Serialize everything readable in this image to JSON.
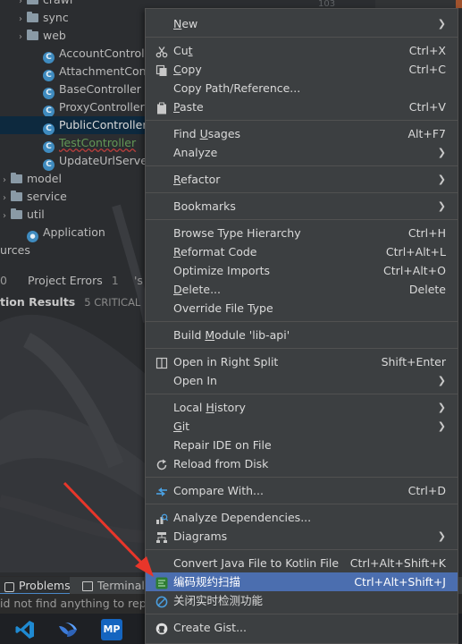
{
  "tree": {
    "items": [
      {
        "label": "crawl",
        "kind": "folder"
      },
      {
        "label": "sync",
        "kind": "folder"
      },
      {
        "label": "web",
        "kind": "folder"
      },
      {
        "label": "AccountController",
        "kind": "class"
      },
      {
        "label": "AttachmentContr",
        "kind": "class"
      },
      {
        "label": "BaseController",
        "kind": "class"
      },
      {
        "label": "ProxyController",
        "kind": "class"
      },
      {
        "label": "PublicController",
        "kind": "class",
        "selected": true
      },
      {
        "label": "TestController",
        "kind": "class",
        "status": "new-file"
      },
      {
        "label": "UpdateUrlServer",
        "kind": "class"
      },
      {
        "label": "model",
        "kind": "folder"
      },
      {
        "label": "service",
        "kind": "folder"
      },
      {
        "label": "util",
        "kind": "folder"
      },
      {
        "label": "Application",
        "kind": "app"
      },
      {
        "label": "urces",
        "kind": "text"
      }
    ]
  },
  "editor": {
    "line_number": "103"
  },
  "tool_tabs": {
    "left_fragment": "0",
    "project_errors": "Project Errors",
    "project_errors_count": "1",
    "right_fragment": "'s"
  },
  "inspection": {
    "title": "tion Results",
    "summary": "5 CRITICAL"
  },
  "status_bar": {
    "problems": "Problems",
    "terminal": "Terminal"
  },
  "message_bar": {
    "text": "id not find anything to repo"
  },
  "taskbar": {
    "icons": [
      "vscode-icon",
      "feishu-icon",
      "mp-icon"
    ],
    "mp_label": "MP"
  },
  "menu": {
    "items": [
      {
        "label": "New",
        "shortcut": "",
        "submenu": true
      },
      {
        "label": "Cut",
        "shortcut": "Ctrl+X",
        "icon": "scissors-icon"
      },
      {
        "label": "Copy",
        "shortcut": "Ctrl+C",
        "icon": "copy-icon"
      },
      {
        "label": "Copy Path/Reference...",
        "shortcut": ""
      },
      {
        "label": "Paste",
        "shortcut": "Ctrl+V",
        "icon": "paste-icon"
      },
      {
        "label": "Find Usages",
        "shortcut": "Alt+F7"
      },
      {
        "label": "Analyze",
        "shortcut": "",
        "submenu": true
      },
      {
        "label": "Refactor",
        "shortcut": "",
        "submenu": true
      },
      {
        "label": "Bookmarks",
        "shortcut": "",
        "submenu": true
      },
      {
        "label": "Browse Type Hierarchy",
        "shortcut": "Ctrl+H"
      },
      {
        "label": "Reformat Code",
        "shortcut": "Ctrl+Alt+L"
      },
      {
        "label": "Optimize Imports",
        "shortcut": "Ctrl+Alt+O"
      },
      {
        "label": "Delete...",
        "shortcut": "Delete"
      },
      {
        "label": "Override File Type",
        "shortcut": ""
      },
      {
        "label": "Build Module 'lib-api'",
        "shortcut": ""
      },
      {
        "label": "Open in Right Split",
        "shortcut": "Shift+Enter",
        "icon": "split-icon"
      },
      {
        "label": "Open In",
        "shortcut": "",
        "submenu": true
      },
      {
        "label": "Local History",
        "shortcut": "",
        "submenu": true
      },
      {
        "label": "Git",
        "shortcut": "",
        "submenu": true
      },
      {
        "label": "Repair IDE on File",
        "shortcut": ""
      },
      {
        "label": "Reload from Disk",
        "shortcut": "",
        "icon": "reload-icon"
      },
      {
        "label": "Compare With...",
        "shortcut": "Ctrl+D",
        "icon": "compare-icon"
      },
      {
        "label": "Analyze Dependencies...",
        "shortcut": "",
        "icon": "dependencies-icon"
      },
      {
        "label": "Diagrams",
        "shortcut": "",
        "submenu": true,
        "icon": "diagram-icon"
      },
      {
        "label": "Convert Java File to Kotlin File",
        "shortcut": "Ctrl+Alt+Shift+K"
      },
      {
        "label": "编码规约扫描",
        "shortcut": "Ctrl+Alt+Shift+J",
        "icon": "p3c-scan-icon",
        "highlighted": true
      },
      {
        "label": "关闭实时检测功能",
        "shortcut": "",
        "icon": "disable-icon"
      },
      {
        "label": "Create Gist...",
        "shortcut": "",
        "icon": "github-icon"
      }
    ],
    "submenu_glyph": "❯",
    "colors": {
      "background": "#3c3f41",
      "highlight": "#4b6eaf",
      "separator": "#515151",
      "text": "#dadada"
    }
  },
  "colors": {
    "annotation_arrow": "#e8362a",
    "selection": "#0d293e",
    "class_icon": "#3f8bbf"
  }
}
